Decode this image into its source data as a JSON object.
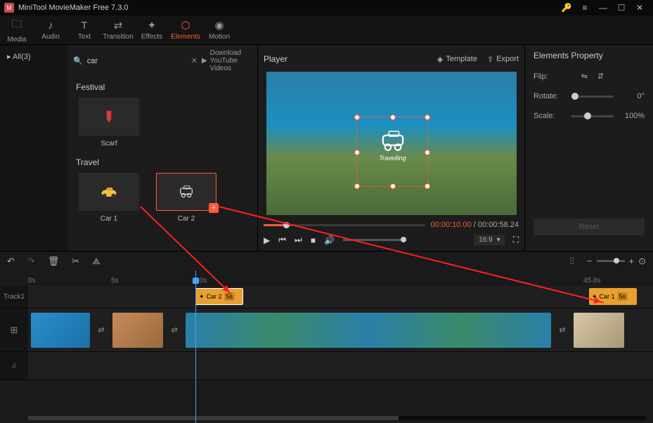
{
  "app": {
    "title": "MiniTool MovieMaker Free 7.3.0"
  },
  "tabs": {
    "media": "Media",
    "audio": "Audio",
    "text": "Text",
    "transition": "Transition",
    "effects": "Effects",
    "elements": "Elements",
    "motion": "Motion"
  },
  "left": {
    "all": "All(3)"
  },
  "search": {
    "value": "car",
    "download": "Download YouTube Videos"
  },
  "cat1": {
    "head": "Festival",
    "item1": "Scarf"
  },
  "cat2": {
    "head": "Travel",
    "item1": "Car 1",
    "item2": "Car 2"
  },
  "player": {
    "title": "Player",
    "template": "Template",
    "export": "Export",
    "overlay": "Travelling",
    "cur": "00:00:10.00",
    "total": " / 00:00:58.24",
    "ratio": "16:9"
  },
  "props": {
    "title": "Elements Property",
    "flip": "Flip:",
    "rotate": "Rotate:",
    "rotval": "0°",
    "scale": "Scale:",
    "scaleval": "100%",
    "reset": "Reset"
  },
  "ruler": {
    "t0": "0s",
    "t5": "5s",
    "t10": "10s",
    "t45": "45.8s"
  },
  "track": {
    "name": "Track1",
    "clip1": "Car 2",
    "clip1d": "5s",
    "clip2": "Car 1",
    "clip2d": "5s"
  }
}
